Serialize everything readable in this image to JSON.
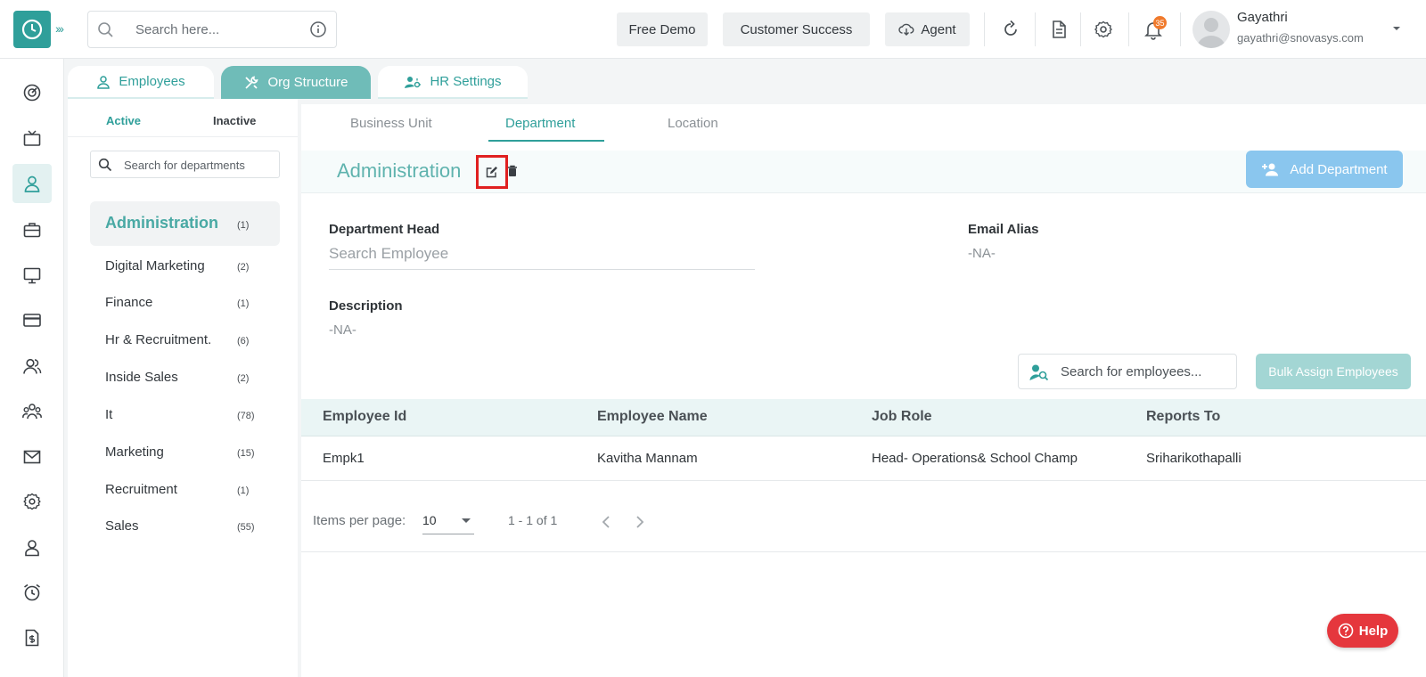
{
  "header": {
    "search_placeholder": "Search here...",
    "buttons": {
      "free_demo": "Free Demo",
      "customer_success": "Customer Success",
      "agent": "Agent"
    },
    "notification_count": "35",
    "user": {
      "name": "Gayathri",
      "email": "gayathri@snovasys.com"
    }
  },
  "rail_icons": [
    "dashboard-icon",
    "tv-icon",
    "user-icon",
    "briefcase-icon",
    "monitor-icon",
    "card-icon",
    "users-icon",
    "team-icon",
    "mail-icon",
    "settings-icon",
    "person-badge-icon",
    "alarm-icon",
    "invoice-icon"
  ],
  "main_tabs": [
    {
      "label": "Employees",
      "active": false
    },
    {
      "label": "Org Structure",
      "active": true
    },
    {
      "label": "HR Settings",
      "active": false
    }
  ],
  "status_tabs": {
    "active": "Active",
    "inactive": "Inactive"
  },
  "dept_search_placeholder": "Search for departments",
  "departments": [
    {
      "name": "Administration",
      "count": "(1)",
      "active": true
    },
    {
      "name": "Digital Marketing",
      "count": "(2)"
    },
    {
      "name": "Finance",
      "count": "(1)"
    },
    {
      "name": "Hr & Recruitment.",
      "count": "(6)"
    },
    {
      "name": "Inside Sales",
      "count": "(2)"
    },
    {
      "name": "It",
      "count": "(78)"
    },
    {
      "name": "Marketing",
      "count": "(15)"
    },
    {
      "name": "Recruitment",
      "count": "(1)"
    },
    {
      "name": "Sales",
      "count": "(55)"
    }
  ],
  "sub_tabs": {
    "business_unit": "Business Unit",
    "department": "Department",
    "location": "Location"
  },
  "detail": {
    "title": "Administration",
    "add_department": "Add Department",
    "department_head_label": "Department Head",
    "department_head_placeholder": "Search Employee",
    "email_alias_label": "Email Alias",
    "email_alias_value": "-NA-",
    "description_label": "Description",
    "description_value": "-NA-"
  },
  "employee_search_placeholder": "Search for employees...",
  "bulk_assign": "Bulk Assign Employees",
  "table": {
    "columns": [
      "Employee Id",
      "Employee Name",
      "Job Role",
      "Reports To"
    ],
    "rows": [
      [
        "Empk1",
        "Kavitha Mannam",
        "Head- Operations& School Champ",
        "Sriharikothapalli"
      ]
    ]
  },
  "pagination": {
    "items_per_page_label": "Items per page:",
    "page_size": "10",
    "range": "1 - 1 of 1"
  },
  "help": "Help",
  "colors": {
    "accent": "#2f9f9a",
    "add_button": "#8ac6ee",
    "help": "#e5373d",
    "highlight": "#e02020"
  }
}
